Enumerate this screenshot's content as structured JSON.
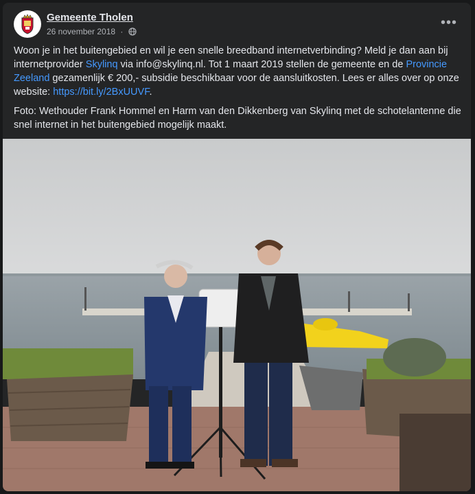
{
  "post": {
    "page_name": "Gemeente Tholen",
    "date": "26 november 2018",
    "date_separator": " · ",
    "audience_icon": "globe-icon",
    "more_icon": "more-options-icon",
    "more_label": "•••",
    "paragraph1": {
      "t1": "Woon je in het buitengebied en wil je een snelle breedband internetverbinding? Meld je dan aan bij internetprovider ",
      "link1": "Skylinq",
      "t2": " via info@skylinq.nl. Tot 1 maart 2019 stellen de gemeente en de ",
      "link2": "Provincie Zeeland",
      "t3": " gezamenlijk € 200,- subsidie beschikbaar voor de aansluitkosten. Lees er alles over op onze website: ",
      "link3": "https://bit.ly/2BxUUVF",
      "t4": "."
    },
    "paragraph2": "Foto: Wethouder Frank Hommel en Harm van den Dikkenberg van Skylinq met de schotelantenne die snel internet in het buitengebied mogelijk maakt."
  },
  "colors": {
    "background": "#18191a",
    "card": "#242526",
    "text": "#e4e6eb",
    "secondary_text": "#b0b3b8",
    "link": "#4599ff"
  }
}
